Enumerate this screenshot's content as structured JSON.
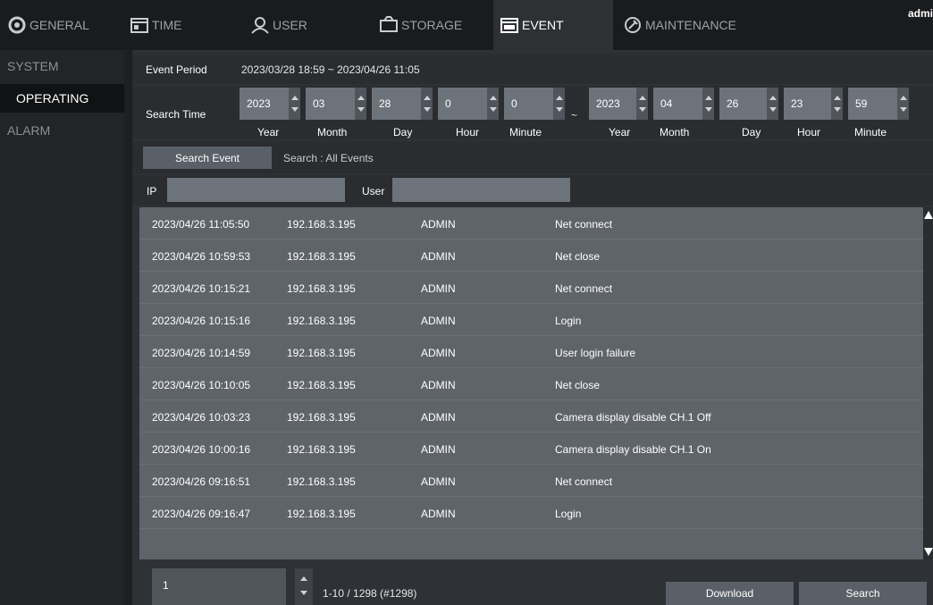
{
  "topnav": {
    "tabs": [
      {
        "label": "GENERAL",
        "icon": "gear-icon"
      },
      {
        "label": "TIME",
        "icon": "calendar-icon"
      },
      {
        "label": "USER",
        "icon": "user-icon"
      },
      {
        "label": "STORAGE",
        "icon": "hdd-icon"
      },
      {
        "label": "EVENT",
        "icon": "event-log-icon"
      },
      {
        "label": "MAINTENANCE",
        "icon": "wrench-icon"
      }
    ],
    "active_tab": "EVENT",
    "user": "admi"
  },
  "sidebar": {
    "items": [
      {
        "label": "SYSTEM"
      },
      {
        "label": "OPERATING"
      },
      {
        "label": "ALARM"
      }
    ],
    "active_item": "OPERATING"
  },
  "event_period": {
    "label": "Event Period",
    "value": "2023/03/28 18:59 ~ 2023/04/26 11:05"
  },
  "search_time": {
    "label": "Search Time",
    "separator": "~",
    "start": [
      {
        "value": "2023",
        "unit": "Year"
      },
      {
        "value": "03",
        "unit": "Month"
      },
      {
        "value": "28",
        "unit": "Day"
      },
      {
        "value": "0",
        "unit": "Hour"
      },
      {
        "value": "0",
        "unit": "Minute"
      }
    ],
    "end": [
      {
        "value": "2023",
        "unit": "Year"
      },
      {
        "value": "04",
        "unit": "Month"
      },
      {
        "value": "26",
        "unit": "Day"
      },
      {
        "value": "23",
        "unit": "Hour"
      },
      {
        "value": "59",
        "unit": "Minute"
      }
    ]
  },
  "search_event": {
    "button_label": "Search Event",
    "scope_text": "Search : All Events"
  },
  "filters": {
    "ip_label": "IP",
    "ip_value": "",
    "user_label": "User",
    "user_value": ""
  },
  "events": [
    {
      "time": "2023/04/26 11:05:50",
      "ip": "192.168.3.195",
      "user": "ADMIN",
      "event": "Net connect"
    },
    {
      "time": "2023/04/26 10:59:53",
      "ip": "192.168.3.195",
      "user": "ADMIN",
      "event": "Net close"
    },
    {
      "time": "2023/04/26 10:15:21",
      "ip": "192.168.3.195",
      "user": "ADMIN",
      "event": "Net connect"
    },
    {
      "time": "2023/04/26 10:15:16",
      "ip": "192.168.3.195",
      "user": "ADMIN",
      "event": "Login"
    },
    {
      "time": "2023/04/26 10:14:59",
      "ip": "192.168.3.195",
      "user": "ADMIN",
      "event": "User login failure"
    },
    {
      "time": "2023/04/26 10:10:05",
      "ip": "192.168.3.195",
      "user": "ADMIN",
      "event": "Net close"
    },
    {
      "time": "2023/04/26 10:03:23",
      "ip": "192.168.3.195",
      "user": "ADMIN",
      "event": "Camera display disable CH.1 Off"
    },
    {
      "time": "2023/04/26 10:00:16",
      "ip": "192.168.3.195",
      "user": "ADMIN",
      "event": "Camera display disable CH.1 On"
    },
    {
      "time": "2023/04/26 09:16:51",
      "ip": "192.168.3.195",
      "user": "ADMIN",
      "event": "Net connect"
    },
    {
      "time": "2023/04/26 09:16:47",
      "ip": "192.168.3.195",
      "user": "ADMIN",
      "event": "Login"
    }
  ],
  "pager": {
    "page": "1",
    "summary": "1-10 / 1298 (#1298)",
    "download_label": "Download",
    "search_label": "Search"
  },
  "colors": {
    "background": "#1e1f21",
    "panel": "#2e3135",
    "list_bg": "#5f646b",
    "input_bg": "#6d737b",
    "active_tab": "#2e3033"
  }
}
